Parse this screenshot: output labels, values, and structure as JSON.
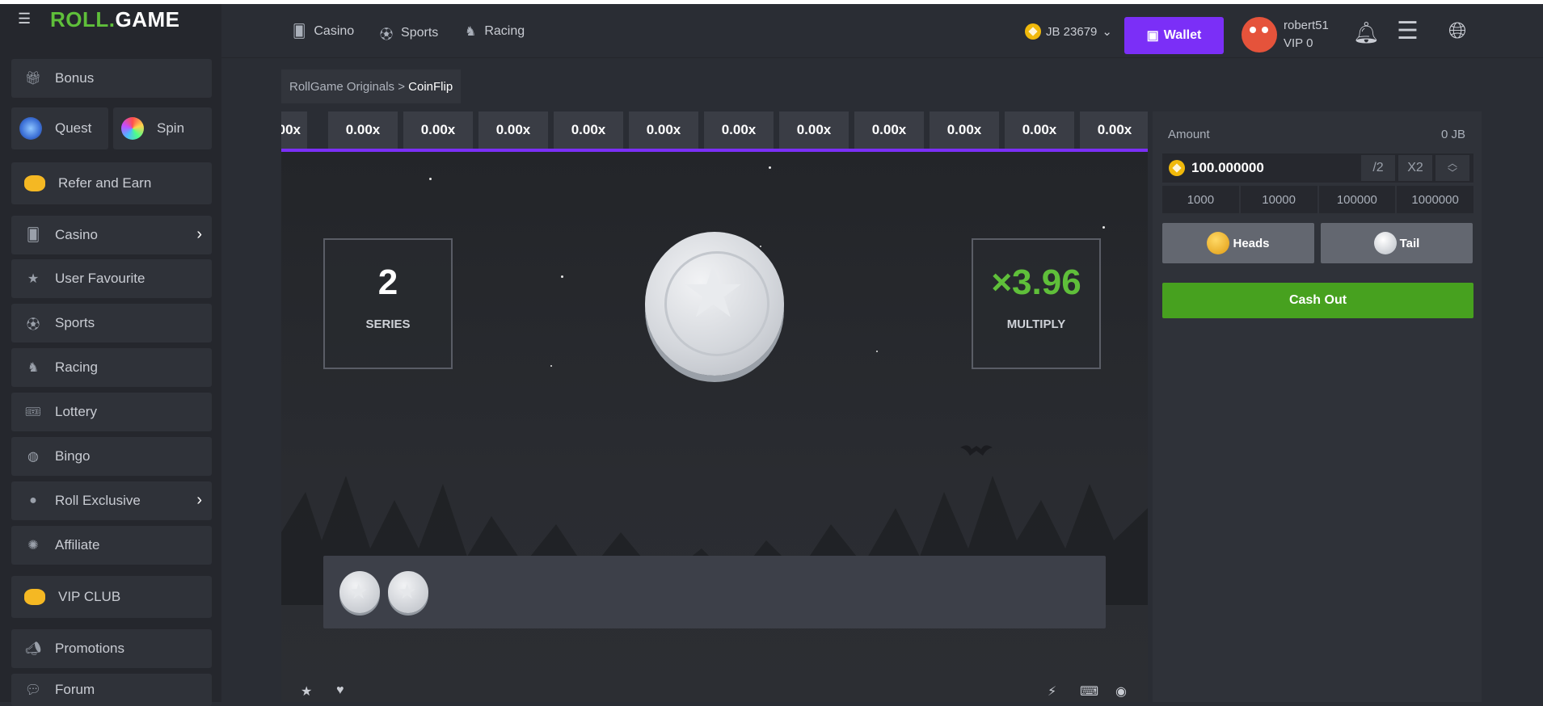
{
  "brand": {
    "part1": "ROLL",
    "dot": ".",
    "part2": "GAME"
  },
  "sidebar": {
    "items": [
      {
        "label": "Bonus"
      },
      {
        "label": "Quest"
      },
      {
        "label": "Spin"
      },
      {
        "label": "Refer and Earn"
      },
      {
        "label": "Casino"
      },
      {
        "label": "User Favourite"
      },
      {
        "label": "Sports"
      },
      {
        "label": "Racing"
      },
      {
        "label": "Lottery"
      },
      {
        "label": "Bingo"
      },
      {
        "label": "Roll Exclusive"
      },
      {
        "label": "Affiliate"
      },
      {
        "label": "VIP CLUB"
      },
      {
        "label": "Promotions"
      },
      {
        "label": "Forum"
      }
    ]
  },
  "header": {
    "nav": [
      {
        "label": "Casino"
      },
      {
        "label": "Sports"
      },
      {
        "label": "Racing"
      }
    ],
    "balance": "JB 23679",
    "wallet_label": "Wallet",
    "user": {
      "name": "robert51",
      "vip": "VIP 0"
    }
  },
  "breadcrumb": {
    "parent": "RollGame Originals",
    "separator": " > ",
    "current": "CoinFlip"
  },
  "game": {
    "multipliers": [
      "00x",
      "0.00x",
      "0.00x",
      "0.00x",
      "0.00x",
      "0.00x",
      "0.00x",
      "0.00x",
      "0.00x",
      "0.00x",
      "0.00x",
      "0.00x"
    ],
    "series": {
      "value": "2",
      "label": "SERIES"
    },
    "multiply": {
      "value": "×3.96",
      "label": "MULTIPLY"
    },
    "history_count": 2
  },
  "bet": {
    "amount_label": "Amount",
    "balance": "0 JB",
    "amount_value": "100.000000",
    "half_label": "/2",
    "double_label": "X2",
    "quick": [
      "1000",
      "10000",
      "100000",
      "1000000"
    ],
    "heads_label": "Heads",
    "tail_label": "Tail",
    "cashout_label": "Cash Out"
  },
  "colors": {
    "accent": "#7b2ff7",
    "green": "#5fbf3a",
    "cashout": "#47a11f",
    "coin_gold": "#f0b90b"
  }
}
